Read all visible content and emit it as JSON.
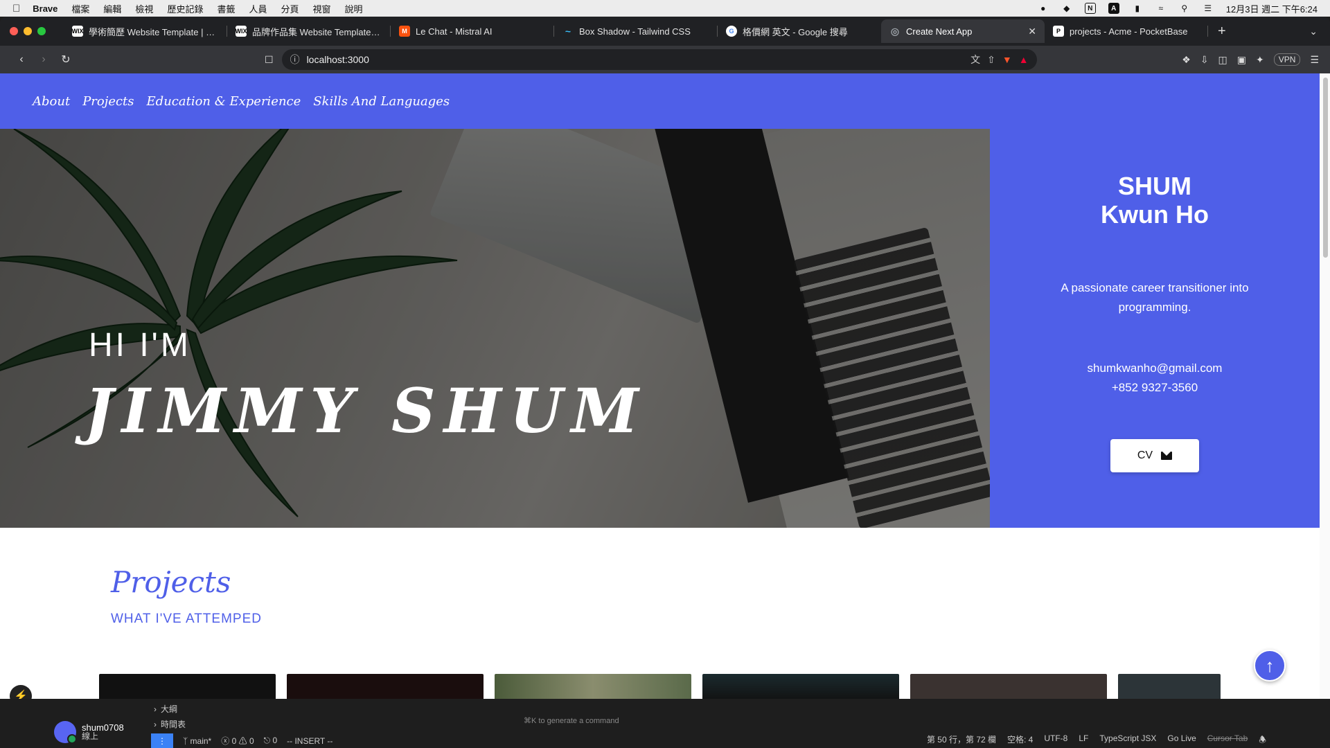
{
  "menubar": {
    "app_name": "Brave",
    "items": [
      "檔案",
      "編輯",
      "檢視",
      "歷史記錄",
      "書籤",
      "人員",
      "分頁",
      "視窗",
      "說明"
    ],
    "datetime": "12月3日 週二 下午6:24"
  },
  "tabs": [
    {
      "label": "學術簡歷 Website Template | WIX",
      "favicon": "WIX",
      "color": "#ffffff",
      "active": false
    },
    {
      "label": "品牌作品集 Website Template | WIX",
      "favicon": "WIX",
      "color": "#ffffff",
      "active": false
    },
    {
      "label": "Le Chat - Mistral AI",
      "favicon": "M",
      "color": "#fa520f",
      "active": false
    },
    {
      "label": "Box Shadow - Tailwind CSS",
      "favicon": "~",
      "color": "#38bdf8",
      "active": false
    },
    {
      "label": "格價網 英文 - Google 搜尋",
      "favicon": "G",
      "color": "#ffffff",
      "active": false
    },
    {
      "label": "Create Next App",
      "favicon": "◎",
      "color": "#9aa0a6",
      "active": true
    },
    {
      "label": "projects - Acme - PocketBase",
      "favicon": "P",
      "color": "#ffffff",
      "active": false
    }
  ],
  "address_bar": {
    "url": "localhost:3000"
  },
  "toolbar": {
    "vpn_label": "VPN"
  },
  "site": {
    "nav": [
      "About",
      "Projects",
      "Education & Experience",
      "Skills And Languages"
    ],
    "hero_greeting": "HI I'M",
    "hero_name": "JIMMY SHUM",
    "side_name_line1": "SHUM",
    "side_name_line2": "Kwun Ho",
    "bio": "A passionate career transitioner into programming.",
    "email": "shumkwanho@gmail.com",
    "phone": "+852 9327-3560",
    "cv_label": "CV",
    "projects_title": "Projects",
    "projects_subtitle": "WHAT I'VE ATTEMPED",
    "accent_color": "#4f5fe8"
  },
  "ide": {
    "outline_items": [
      "大綱",
      "時間表"
    ],
    "hint": "⌘K to generate a command",
    "user_name": "shum0708",
    "user_status": "線上",
    "branch": "main*",
    "errors": "0",
    "warnings": "0",
    "ports": "0",
    "mode": "-- INSERT --",
    "position": "第 50 行，第 72 欄",
    "spaces": "空格: 4",
    "encoding": "UTF-8",
    "eol": "LF",
    "language": "TypeScript JSX",
    "go_live": "Go Live",
    "cursor_tab": "Cursor Tab"
  }
}
